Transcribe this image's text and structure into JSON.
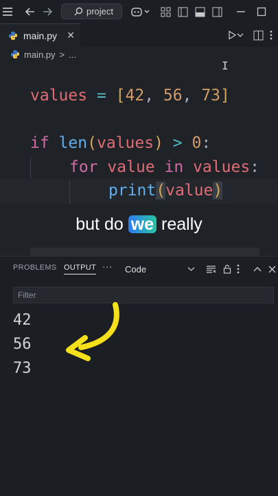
{
  "titlebar": {
    "search_label": "project"
  },
  "tab": {
    "filename": "main.py",
    "close": "✕"
  },
  "breadcrumb": {
    "file": "main.py",
    "separator": ">",
    "more": "..."
  },
  "code": {
    "l1": {
      "var": "values",
      "eq": " = ",
      "open": "[",
      "n1": "42",
      "c1": ", ",
      "n2": "56",
      "c2": ", ",
      "n3": "73",
      "close": "]"
    },
    "l2": {
      "kw": "if",
      "fn": "len",
      "open": "(",
      "arg": "values",
      "close": ")",
      "gt": " > ",
      "zero": "0",
      "colon": ":"
    },
    "l3": {
      "kw1": "for",
      "v": "value",
      "kw2": "in",
      "it": "values",
      "colon": ":"
    },
    "l4": {
      "fn": "print",
      "open": "(",
      "arg": "value",
      "close": ")"
    }
  },
  "caption": {
    "pre": "but do ",
    "hl": "we",
    "post": " really"
  },
  "panel": {
    "tabs": [
      "PROBLEMS",
      "OUTPUT"
    ],
    "active_tab": "OUTPUT",
    "more": "···",
    "channel": "Code",
    "filter_placeholder": "Filter",
    "output": [
      "42",
      "56",
      "73"
    ]
  },
  "colors": {
    "arrow": "#f5e11b",
    "highlight_start": "#2f7bf0",
    "highlight_end": "#27c4a0"
  }
}
